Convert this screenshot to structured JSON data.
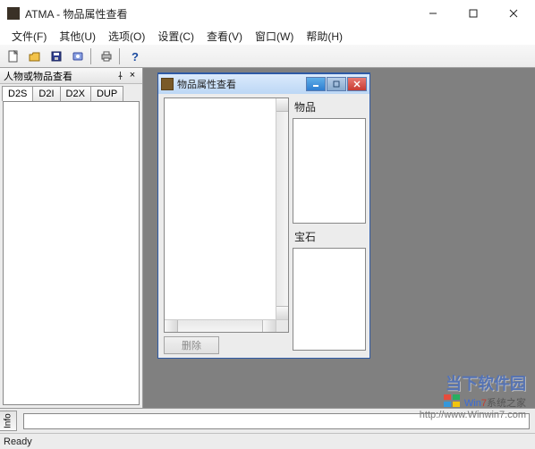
{
  "title": "ATMA - 物品属性查看",
  "menu": [
    "文件(F)",
    "其他(U)",
    "选项(O)",
    "设置(C)",
    "查看(V)",
    "窗口(W)",
    "帮助(H)"
  ],
  "left_pane": {
    "title": "人物或物品查看",
    "tabs": [
      "D2S",
      "D2I",
      "D2X",
      "DUP"
    ]
  },
  "child": {
    "title": "物品属性查看",
    "section_item": "物品",
    "section_gem": "宝石",
    "delete_btn": "删除"
  },
  "info_tab": "Info",
  "status": "Ready",
  "watermark": {
    "line1": "当下软件园",
    "brand_a": "Win",
    "brand_b": "7",
    "brand_c": "系统之家",
    "url": "http://www.Winwin7.com"
  }
}
